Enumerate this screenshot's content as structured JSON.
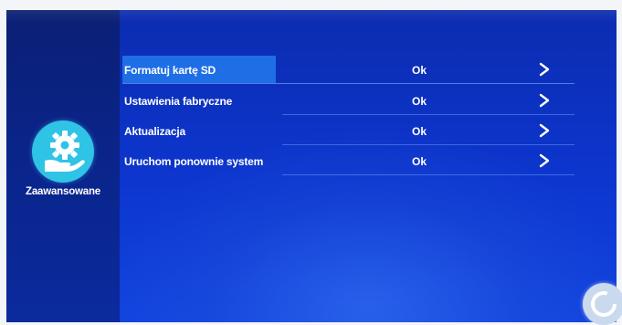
{
  "sidebar": {
    "icon": "gear-hand-icon",
    "label": "Zaawansowane"
  },
  "menu": [
    {
      "label": "Formatuj kartę SD",
      "value": "Ok",
      "selected": true
    },
    {
      "label": "Ustawienia fabryczne",
      "value": "Ok",
      "selected": false
    },
    {
      "label": "Aktualizacja",
      "value": "Ok",
      "selected": false
    },
    {
      "label": "Uruchom ponownie system",
      "value": "Ok",
      "selected": false
    }
  ],
  "colors": {
    "accent": "#1e6ee6",
    "icon_bg": "#2fc3e6",
    "background": "#0b2cb0"
  },
  "corner_button": {
    "icon": "refresh-icon"
  }
}
